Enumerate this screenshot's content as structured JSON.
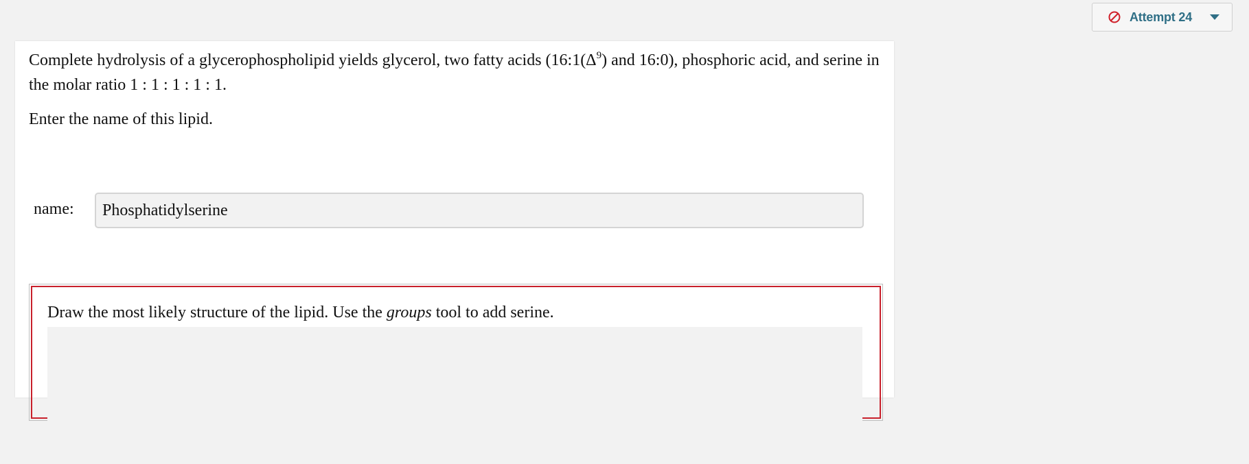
{
  "attempt": {
    "label": "Attempt 24",
    "status_icon": "ban-icon",
    "status_color": "#d0202a",
    "menu_icon": "caret-down-icon"
  },
  "question": {
    "text_before_sup": "Complete hydrolysis of a glycerophospholipid yields glycerol, two fatty acids (16:1(Δ",
    "superscript": "9",
    "text_after_sup": ") and 16:0), phosphoric acid, and serine in the molar ratio 1 : 1 : 1 : 1 : 1.",
    "instruction": "Enter the name of this lipid."
  },
  "answer": {
    "label": "name:",
    "value": "Phosphatidylserine"
  },
  "drawing": {
    "prompt_before": "Draw the most likely structure of the lipid. Use the ",
    "prompt_italic": "groups",
    "prompt_after": " tool to add serine.",
    "border_color": "#c8202b"
  }
}
